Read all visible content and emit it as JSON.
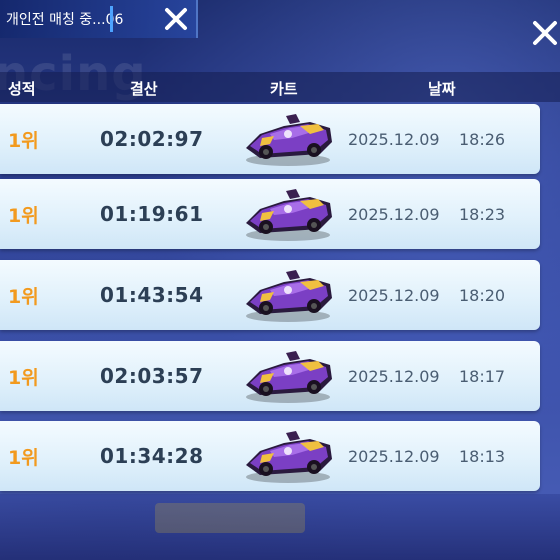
{
  "match_status": {
    "text": "개인전 매칭 중...06"
  },
  "watermark": "ncing",
  "columns": {
    "rank": "성적",
    "time": "결산",
    "kart": "카트",
    "date": "날짜"
  },
  "records": [
    {
      "rank": "1위",
      "time": "02:02:97",
      "date": "2025.12.09",
      "clock": "18:26"
    },
    {
      "rank": "1위",
      "time": "01:19:61",
      "date": "2025.12.09",
      "clock": "18:23"
    },
    {
      "rank": "1위",
      "time": "01:43:54",
      "date": "2025.12.09",
      "clock": "18:20"
    },
    {
      "rank": "1위",
      "time": "02:03:57",
      "date": "2025.12.09",
      "clock": "18:17"
    },
    {
      "rank": "1위",
      "time": "01:34:28",
      "date": "2025.12.09",
      "clock": "18:13"
    }
  ],
  "colors": {
    "rank": "#f29a1e",
    "kart_body": "#7b3fc4",
    "row_bg": "#e4f3fc"
  },
  "icons": {
    "close": "close-x-icon",
    "kart": "kart-icon"
  }
}
